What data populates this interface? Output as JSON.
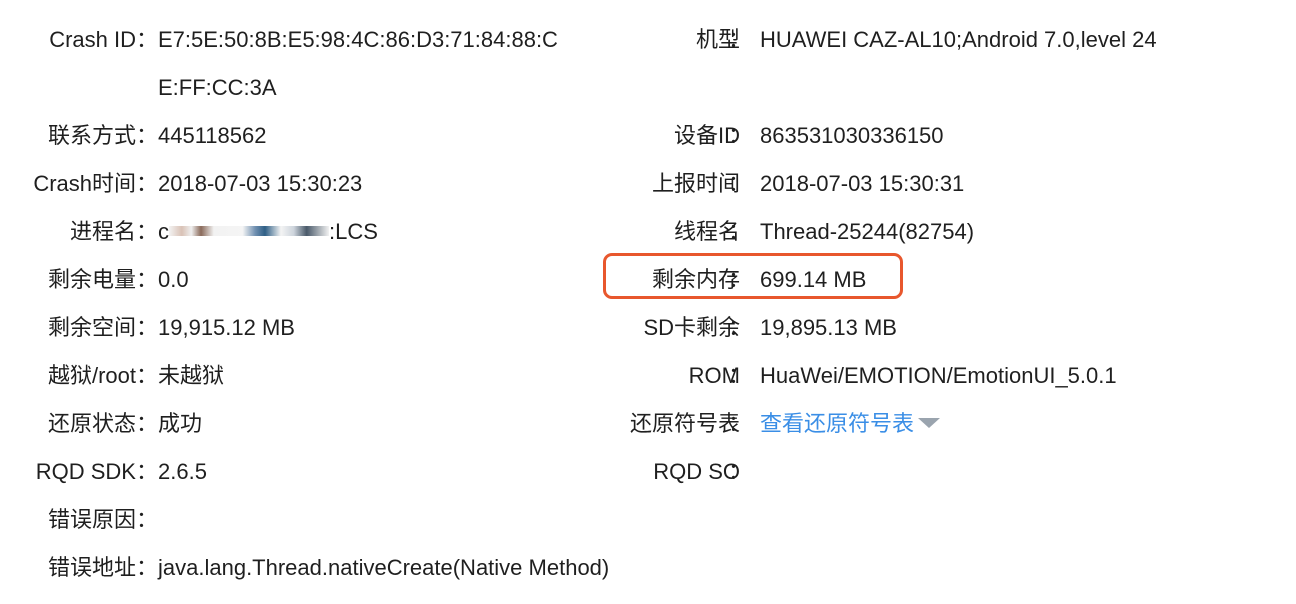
{
  "colors": {
    "text": "#1f1f1f",
    "link": "#3a8ee6",
    "highlight_border": "#e8572d",
    "caret": "#9aa4ae"
  },
  "left": {
    "crash_id": {
      "label": "Crash ID",
      "value_line1": "E7:5E:50:8B:E5:98:4C:86:D3:71:84:88:C",
      "value_line2": "E:FF:CC:3A"
    },
    "contact": {
      "label": "联系方式",
      "value": "445118562"
    },
    "crash_time": {
      "label": "Crash时间",
      "value": "2018-07-03 15:30:23"
    },
    "process_name": {
      "label": "进程名",
      "value_prefix": "c",
      "value_suffix": ":LCS"
    },
    "battery": {
      "label": "剩余电量",
      "value": "0.0"
    },
    "free_space": {
      "label": "剩余空间",
      "value": "19,915.12 MB"
    },
    "jailbreak": {
      "label": "越狱/root",
      "value": "未越狱"
    },
    "restore_state": {
      "label": "还原状态",
      "value": "成功"
    },
    "rqd_sdk": {
      "label": "RQD SDK",
      "value": "2.6.5"
    },
    "error_reason": {
      "label": "错误原因",
      "value": ""
    },
    "error_address": {
      "label": "错误地址",
      "value": "java.lang.Thread.nativeCreate(Native Method)"
    }
  },
  "right": {
    "model": {
      "label": "机型",
      "value": "HUAWEI CAZ-AL10;Android 7.0,level 24"
    },
    "device_id": {
      "label": "设备ID",
      "value": "863531030336150"
    },
    "report_time": {
      "label": "上报时间",
      "value": "2018-07-03 15:30:31"
    },
    "thread_name": {
      "label": "线程名",
      "value": "Thread-25244(82754)"
    },
    "free_memory": {
      "label": "剩余内存",
      "value": "699.14 MB"
    },
    "sd_free": {
      "label": "SD卡剩余",
      "value": "19,895.13 MB"
    },
    "rom": {
      "label": "ROM",
      "value": "HuaWei/EMOTION/EmotionUI_5.0.1"
    },
    "symbol_table": {
      "label": "还原符号表",
      "link_text": "查看还原符号表",
      "icon": "caret-down-icon"
    },
    "rqd_so": {
      "label": "RQD SO",
      "value": ""
    }
  },
  "colon": "："
}
